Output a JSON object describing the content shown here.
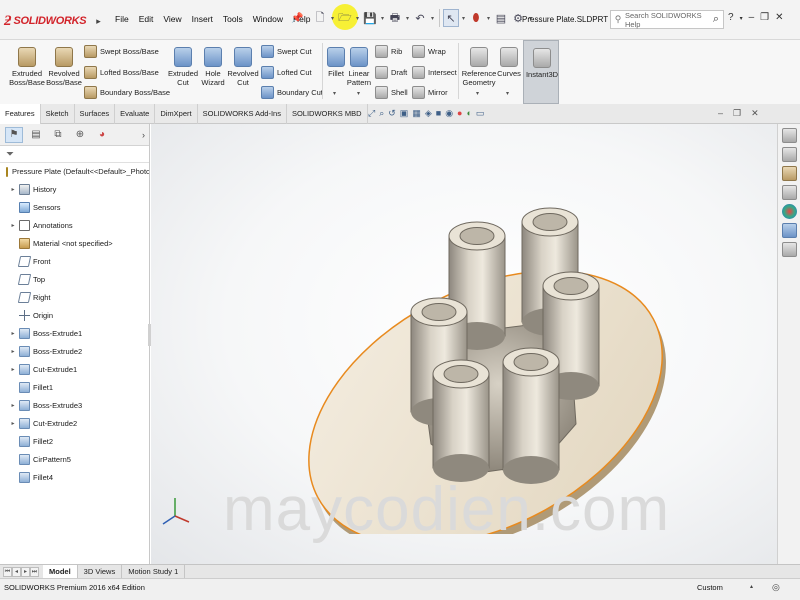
{
  "app": {
    "logo_text": "SOLIDWORKS",
    "document_title": "Pressure Plate.SLDPRT",
    "help_placeholder": "Search SOLIDWORKS Help"
  },
  "menu": [
    "File",
    "Edit",
    "View",
    "Insert",
    "Tools",
    "Window",
    "Help"
  ],
  "ribbon": {
    "extruded_boss": "Extruded\nBoss/Base",
    "revolved_boss": "Revolved\nBoss/Base",
    "swept_boss": "Swept Boss/Base",
    "lofted_boss": "Lofted Boss/Base",
    "boundary_boss": "Boundary Boss/Base",
    "extruded_cut": "Extruded\nCut",
    "hole_wizard": "Hole\nWizard",
    "revolved_cut": "Revolved\nCut",
    "swept_cut": "Swept Cut",
    "lofted_cut": "Lofted Cut",
    "boundary_cut": "Boundary Cut",
    "fillet": "Fillet",
    "linear_pattern": "Linear\nPattern",
    "rib": "Rib",
    "draft": "Draft",
    "shell": "Shell",
    "wrap": "Wrap",
    "intersect": "Intersect",
    "mirror": "Mirror",
    "reference_geometry": "Reference\nGeometry",
    "curves": "Curves",
    "instant3d": "Instant3D"
  },
  "command_tabs": [
    "Features",
    "Sketch",
    "Surfaces",
    "Evaluate",
    "DimXpert",
    "SOLIDWORKS Add-Ins",
    "SOLIDWORKS MBD"
  ],
  "active_command_tab": "Features",
  "tree": {
    "root": "Pressure Plate  (Default<<Default>_Photo",
    "items": [
      {
        "label": "History",
        "icon": "history-icon",
        "expandable": true
      },
      {
        "label": "Sensors",
        "icon": "sensor-icon",
        "expandable": false
      },
      {
        "label": "Annotations",
        "icon": "annotation-icon",
        "expandable": true
      },
      {
        "label": "Material <not specified>",
        "icon": "material-icon",
        "expandable": false
      },
      {
        "label": "Front",
        "icon": "plane-icon",
        "expandable": false
      },
      {
        "label": "Top",
        "icon": "plane-icon",
        "expandable": false
      },
      {
        "label": "Right",
        "icon": "plane-icon",
        "expandable": false
      },
      {
        "label": "Origin",
        "icon": "origin-icon",
        "expandable": false
      },
      {
        "label": "Boss-Extrude1",
        "icon": "feature-icon",
        "expandable": true
      },
      {
        "label": "Boss-Extrude2",
        "icon": "feature-icon",
        "expandable": true
      },
      {
        "label": "Cut-Extrude1",
        "icon": "feature-icon",
        "expandable": true
      },
      {
        "label": "Fillet1",
        "icon": "feature-icon",
        "expandable": false
      },
      {
        "label": "Boss-Extrude3",
        "icon": "feature-icon",
        "expandable": true
      },
      {
        "label": "Cut-Extrude2",
        "icon": "feature-icon",
        "expandable": true
      },
      {
        "label": "Fillet2",
        "icon": "feature-icon",
        "expandable": false
      },
      {
        "label": "CirPattern5",
        "icon": "feature-icon",
        "expandable": false
      },
      {
        "label": "Fillet4",
        "icon": "feature-icon",
        "expandable": false
      }
    ]
  },
  "bottom_tabs": [
    "Model",
    "3D Views",
    "Motion Study 1"
  ],
  "active_bottom_tab": "Model",
  "status": {
    "text": "SOLIDWORKS Premium 2016 x64 Edition",
    "units": "Custom"
  },
  "watermark": "maycodien.com",
  "colors": {
    "brand_red": "#d2232a",
    "highlight_yellow": "#f7ef2a",
    "model_tan": "#ece2cf",
    "edge_orange": "#e88a1e"
  }
}
